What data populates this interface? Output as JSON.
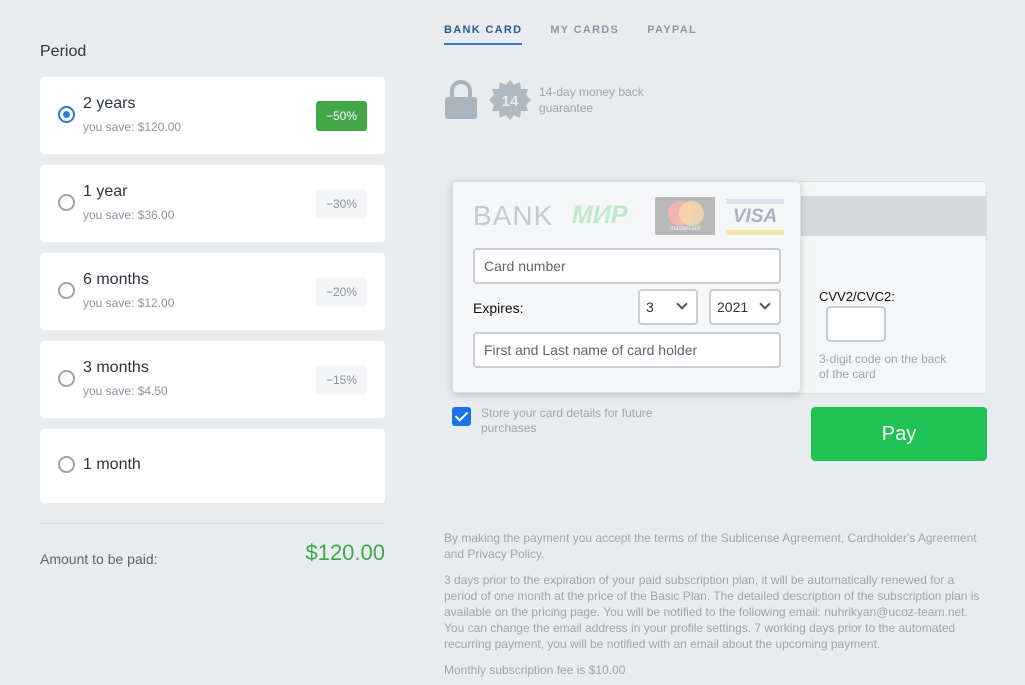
{
  "period": {
    "title": "Period",
    "plans": [
      {
        "name": "2 years",
        "save": "you save: $120.00",
        "badge": "−50%",
        "selected": true
      },
      {
        "name": "1 year",
        "save": "you save: $36.00",
        "badge": "−30%",
        "selected": false
      },
      {
        "name": "6 months",
        "save": "you save: $12.00",
        "badge": "−20%",
        "selected": false
      },
      {
        "name": "3 months",
        "save": "you save: $4.50",
        "badge": "−15%",
        "selected": false
      },
      {
        "name": "1 month",
        "save": "",
        "badge": "",
        "selected": false
      }
    ],
    "amount_label": "Amount to be paid:",
    "amount_value": "$120.00"
  },
  "tabs": {
    "bank_card": "BANK CARD",
    "my_cards": "MY CARDS",
    "paypal": "PAYPAL"
  },
  "guarantee": {
    "days": "14",
    "text": "14-day money back guarantee"
  },
  "card": {
    "bank_label": "BANK",
    "mir_label": "МИР",
    "mastercard_label": "mastercard",
    "visa_label": "VISA",
    "card_number_placeholder": "Card number",
    "expires_label": "Expires:",
    "month": "3",
    "year": "2021",
    "holder_placeholder": "First and Last name of card holder",
    "cvv_label": "CVV2/CVC2:",
    "cvv_hint": "3-digit code on the back of the card"
  },
  "store": {
    "checked": true,
    "text": "Store your card details for future purchases"
  },
  "pay_label": "Pay",
  "legal": {
    "p1": "By making the payment you accept the terms of the Sublicense Agreement, Cardholder's Agreement and Privacy Policy.",
    "p2": "3 days prior to the expiration of your paid subscription plan, it will be automatically renewed for a period of one month at the price of the Basic Plan. The detailed description of the subscription plan is available on the pricing page. You will be notified to the following email: nuhrikyan@ucoz-team.net. You can change the email address in your profile settings. 7 working days prior to the automated recurring payment, you will be notified with an email about the upcoming payment.",
    "p3": "Monthly subscription fee is $10.00"
  },
  "colors": {
    "accent": "#2e7bd6",
    "discount_active": "#43a649",
    "pay_button": "#1fc353"
  }
}
